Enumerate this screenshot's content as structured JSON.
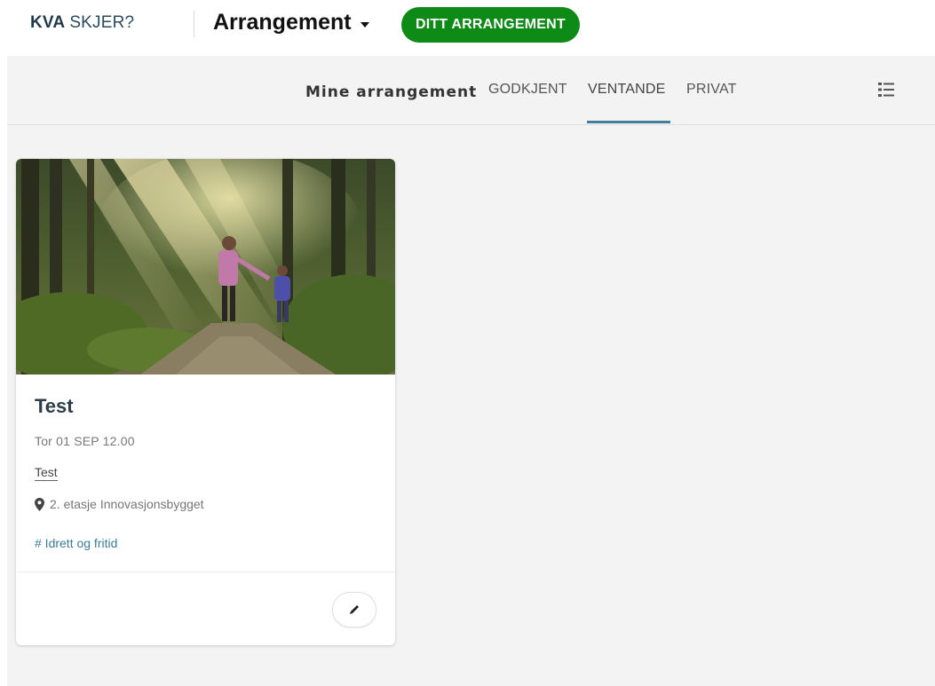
{
  "header": {
    "logo_primary": "KVA",
    "logo_secondary": "SKJER?",
    "section": "Arrangement",
    "cta_label": "DITT ARRANGEMENT"
  },
  "tabs": {
    "title": "Mine arrangement",
    "items": [
      {
        "label": "GODKJENT",
        "active": false
      },
      {
        "label": "VENTANDE",
        "active": true
      },
      {
        "label": "PRIVAT",
        "active": false
      }
    ],
    "view_icon": "list-view-icon"
  },
  "card": {
    "title": "Test",
    "date": "Tor 01 SEP 12.00",
    "description": "Test",
    "location": "2. etasje Innovasjonsbygget",
    "tag": "# Idrett og fritid",
    "edit_icon": "pencil-icon"
  },
  "colors": {
    "brand_dark": "#1f3a4d",
    "cta_green": "#0e8a17",
    "tab_accent": "#3f7f9a",
    "tag_link": "#3b7c9c"
  }
}
